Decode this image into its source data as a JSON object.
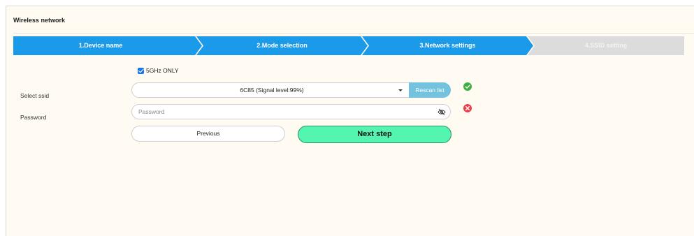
{
  "panel": {
    "title": "Wireless network"
  },
  "steps": [
    {
      "label": "1.Device name",
      "state": "active"
    },
    {
      "label": "2.Mode selection",
      "state": "active"
    },
    {
      "label": "3.Network settings",
      "state": "active"
    },
    {
      "label": "4.SSID setting",
      "state": "inactive"
    }
  ],
  "colors": {
    "step_active": "#1a9ae8",
    "step_inactive": "#dcdcdc",
    "next_button": "#54f5b0",
    "rescan_button": "#73c2de"
  },
  "form": {
    "band_checkbox": {
      "label": "5GHz ONLY",
      "checked": true
    },
    "ssid": {
      "label": "Select ssid",
      "value": "6C85 (Signal level:99%)",
      "status_icon": "check-circle-icon"
    },
    "rescan_label": "Rescan list",
    "password": {
      "label": "Password",
      "placeholder": "Password",
      "value": "",
      "status_icon": "error-circle-icon"
    },
    "previous_label": "Previous",
    "next_label": "Next step"
  }
}
